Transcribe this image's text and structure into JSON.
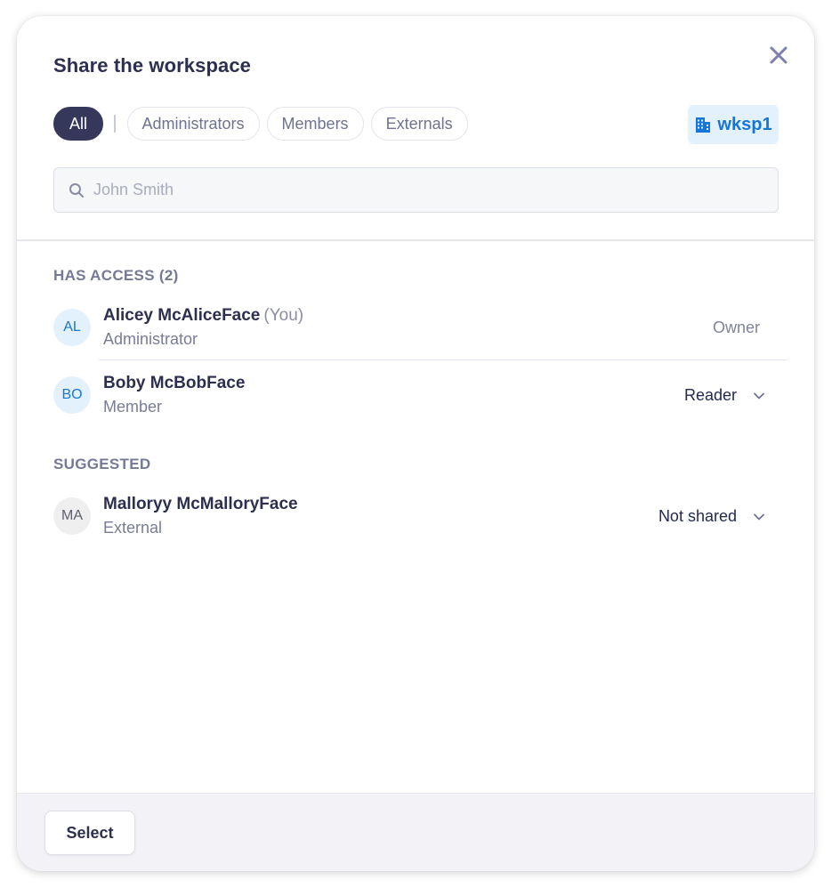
{
  "dialog": {
    "title": "Share the workspace"
  },
  "filters": [
    {
      "label": "All",
      "active": true
    },
    {
      "label": "Administrators",
      "active": false
    },
    {
      "label": "Members",
      "active": false
    },
    {
      "label": "Externals",
      "active": false
    }
  ],
  "workspace_badge": {
    "icon": "building-icon",
    "label": "wksp1",
    "color": "#1676d6"
  },
  "search": {
    "placeholder": "John Smith",
    "value": ""
  },
  "sections": {
    "has_access": {
      "label": "HAS ACCESS (2)",
      "people": [
        {
          "initials": "AL",
          "name": "Alicey McAliceFace",
          "suffix": "(You)",
          "role": "Administrator",
          "permission": "Owner"
        },
        {
          "initials": "BO",
          "name": "Boby McBobFace",
          "role": "Member",
          "permission": "Reader"
        }
      ]
    },
    "suggested": {
      "label": "SUGGESTED",
      "people": [
        {
          "initials": "MA",
          "name": "Malloryy McMalloryFace",
          "role": "External",
          "permission": "Not shared"
        }
      ]
    }
  },
  "footer": {
    "select_label": "Select"
  },
  "colors": {
    "accent": "#1676d6",
    "active_pill": "#36385b",
    "text_primary": "#2d2f4e"
  }
}
